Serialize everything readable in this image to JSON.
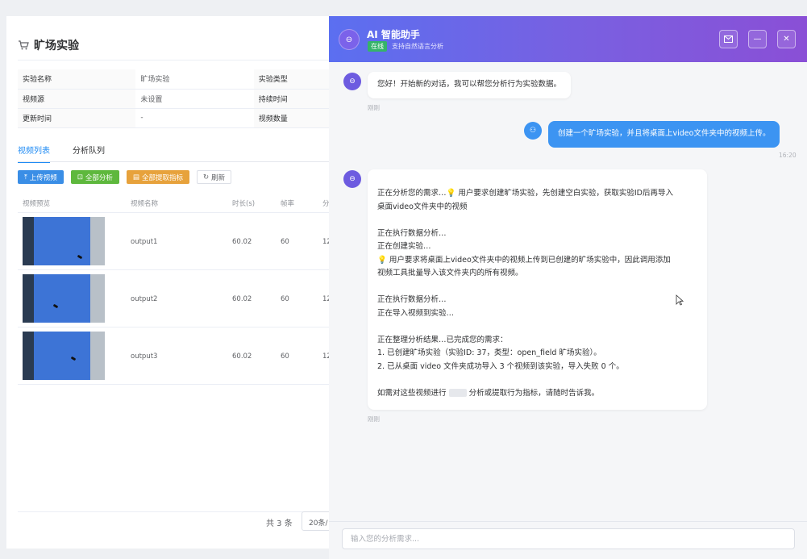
{
  "page": {
    "title": "旷场实验",
    "info": [
      {
        "label": "实验名称",
        "value": "旷场实验",
        "label2": "实验类型"
      },
      {
        "label": "视频源",
        "value": "未设置",
        "label2": "持续时间"
      },
      {
        "label": "更新时间",
        "value": "-",
        "label2": "视频数量"
      }
    ],
    "tabs": [
      "视频列表",
      "分析队列"
    ],
    "active_tab": "视频列表",
    "toolbar": {
      "upload": "上传视频",
      "analyze_all": "全部分析",
      "extract_all": "全部提取指标",
      "refresh": "刷新"
    },
    "table": {
      "headers": [
        "视频预览",
        "视频名称",
        "时长(s)",
        "帧率",
        "分"
      ],
      "rows": [
        {
          "name": "output1",
          "duration": "60.02",
          "fps": "60",
          "extra": "12"
        },
        {
          "name": "output2",
          "duration": "60.02",
          "fps": "60",
          "extra": "12"
        },
        {
          "name": "output3",
          "duration": "60.02",
          "fps": "60",
          "extra": "12"
        }
      ]
    },
    "pagination": {
      "total": "共 3 条",
      "page_size": "20条/"
    }
  },
  "chat": {
    "title": "AI 智能助手",
    "status": "在线",
    "subtitle": "支持自然语言分析",
    "messages": [
      {
        "role": "bot",
        "lines": [
          "您好！开始新的对话，我可以帮您分析行为实验数据。"
        ],
        "time": "刚刚"
      },
      {
        "role": "user",
        "lines": [
          "创建一个旷场实验，并且将桌面上video文件夹中的视频上传。"
        ],
        "time": "16:20"
      },
      {
        "role": "bot",
        "lines": [
          "正在分析您的需求…💡 用户要求创建旷场实验，先创建空白实验，获取实验ID后再导入",
          "桌面video文件夹中的视频",
          "",
          "正在执行数据分析…",
          "正在创建实验…",
          "💡 用户要求将桌面上video文件夹中的视频上传到已创建的旷场实验中，因此调用添加",
          "视频工具批量导入该文件夹内的所有视频。",
          "",
          "正在执行数据分析…",
          "正在导入视频到实验…",
          "",
          "正在整理分析结果…已完成您的需求：",
          "1. 已创建旷场实验（实验ID: 37，类型：open_field 旷场实验）。",
          "2. 已从桌面 video 文件夹成功导入 3 个视频到该实验，导入失败 0 个。",
          "",
          "如需对这些视频进行",
          "分析或提取行为指标，请随时告诉我。"
        ],
        "time": "刚刚"
      }
    ],
    "input_placeholder": "输入您的分析需求..."
  }
}
